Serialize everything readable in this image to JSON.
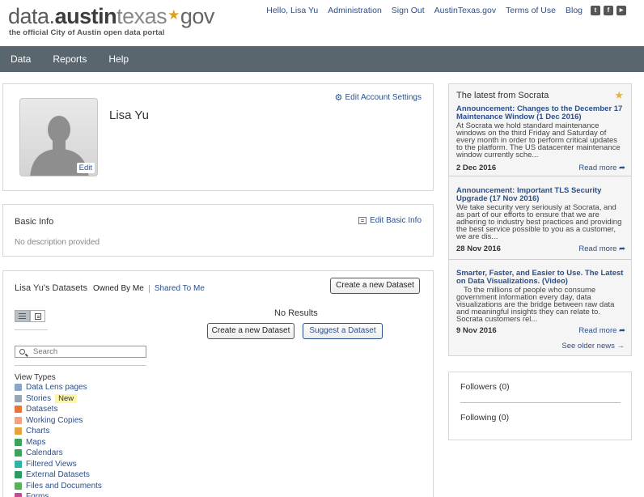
{
  "logo": {
    "part_data": "data.",
    "part_austin": "austin",
    "part_texas": "texas",
    "part_star": "★",
    "part_gov": "gov",
    "tagline": "the official City of Austin open data portal"
  },
  "toplinks": {
    "greeting": "Hello, Lisa Yu",
    "administration": "Administration",
    "signout": "Sign Out",
    "site": "AustinTexas.gov",
    "terms": "Terms of Use",
    "blog": "Blog",
    "social": [
      "twitter-icon",
      "facebook-icon",
      "youtube-icon"
    ]
  },
  "nav": {
    "items": [
      "Data",
      "Reports",
      "Help"
    ]
  },
  "profile": {
    "name": "Lisa Yu",
    "avatar_edit": "Edit",
    "edit_account": "Edit Account Settings"
  },
  "basic_info": {
    "title": "Basic Info",
    "edit": "Edit Basic Info",
    "description": "No description provided"
  },
  "datasets": {
    "title": "Lisa Yu's Datasets",
    "tab_owned": "Owned By Me",
    "tab_shared": "Shared To Me",
    "create_top": "Create a new Dataset",
    "no_results": "No Results",
    "create_mid": "Create a new Dataset",
    "suggest": "Suggest a Dataset",
    "search_placeholder": "Search",
    "view_types_heading": "View Types",
    "new_badge": "New",
    "view_types": [
      {
        "label": "Data Lens pages",
        "icon": "data-lens-icon",
        "color": "#8aa6c7"
      },
      {
        "label": "Stories",
        "icon": "stories-icon",
        "color": "#9aa5b2"
      },
      {
        "label": "Datasets",
        "icon": "datasets-icon",
        "color": "#e8743b"
      },
      {
        "label": "Working Copies",
        "icon": "working-copies-icon",
        "color": "#f2a37e"
      },
      {
        "label": "Charts",
        "icon": "charts-icon",
        "color": "#e8a23b"
      },
      {
        "label": "Maps",
        "icon": "maps-icon",
        "color": "#3da35a"
      },
      {
        "label": "Calendars",
        "icon": "calendars-icon",
        "color": "#3da35a"
      },
      {
        "label": "Filtered Views",
        "icon": "filtered-views-icon",
        "color": "#2bb5a8"
      },
      {
        "label": "External Datasets",
        "icon": "external-datasets-icon",
        "color": "#2e9a63"
      },
      {
        "label": "Files and Documents",
        "icon": "files-documents-icon",
        "color": "#56b05c"
      },
      {
        "label": "Forms",
        "icon": "forms-icon",
        "color": "#c9489a"
      }
    ]
  },
  "news": {
    "heading": "The latest from Socrata",
    "items": [
      {
        "title": "Announcement: Changes to the December 17 Maintenance Window (1 Dec 2016)",
        "body": "At Socrata we hold standard maintenance windows on the third Friday and Saturday of every month in order to perform critical updates to the platform. The US datacenter maintenance window currently sche...",
        "date": "2 Dec 2016",
        "more": "Read more ➦"
      },
      {
        "title": "Announcement: Important TLS Security Upgrade (17 Nov 2016)",
        "body": "We take security very seriously at Socrata, and as part of our efforts to ensure that we are adhering to industry best practices and providing the best service possible to you as a customer, we are dis...",
        "date": "28 Nov 2016",
        "more": "Read more ➦"
      },
      {
        "title": "Smarter, Faster, and Easier to Use. The Latest on Data Visualizations. (Video)",
        "body": "To the millions of people who consume government information every day, data visualizations are the bridge between raw data and meaningful insights they can relate to. Socrata customers rel...",
        "date": "9 Nov 2016",
        "more": "Read more ➦"
      }
    ],
    "see_older": "See older news →"
  },
  "follow": {
    "followers": "Followers (0)",
    "following": "Following (0)"
  }
}
